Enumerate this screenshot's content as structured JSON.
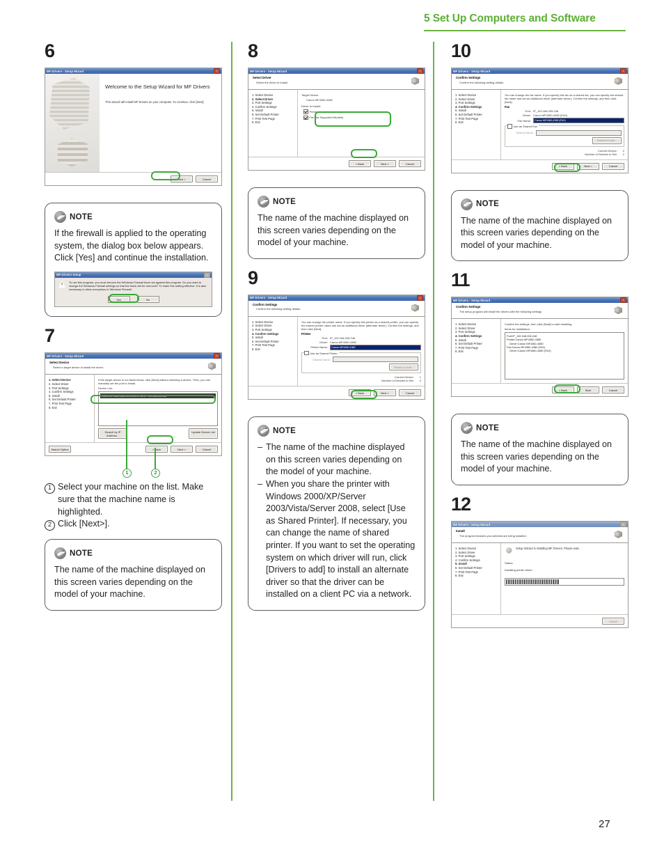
{
  "header": {
    "title": "5 Set Up Computers and Software"
  },
  "page_number": "27",
  "common": {
    "wizard_title": "MF Drivers - Setup Wizard",
    "steps": [
      "1.  Select Device",
      "2.  Select Driver",
      "3.  Port Settings",
      "4.  Confirm Settings",
      "5.  Install",
      "6.  Set Default Printer",
      "7.  Print Test Page",
      "8.  Exit"
    ],
    "btn_back": "< Back",
    "btn_next": "Next >",
    "btn_cancel": "Cancel",
    "btn_start": "Start",
    "note_label": "NOTE",
    "note_machine_name": "The name of the machine displayed on this screen varies depending on the model of your machine."
  },
  "step6": {
    "number": "6",
    "welcome_title": "Welcome to the Setup Wizard for MF Drivers",
    "welcome_body": "This wizard will install MF Drivers on your computer. To continue, click [Next].",
    "note": {
      "text": "If the firewall is applied to the operating system, the dialog box below appears. Click [Yes] and continue the installation.",
      "dialog": {
        "title": "MF Drivers Setup",
        "body": "To use this program, you must remove the Windows Firewall block set against this program. Do you want to change the Windows Firewall settings so that the block will be removed? To make this setting effective, it is also necessary to allow exceptions in Windows Firewall.",
        "yes": "Yes",
        "no": "No"
      }
    }
  },
  "step7": {
    "number": "7",
    "band_title": "Select Device",
    "band_sub": "Select a target device to install the driver.",
    "intro": "If the target device is not listed below, click [Next] without selecting a device. Then, you can manually set the port to install.",
    "list_label": "Device List:",
    "device_row": "Canon MF4360-4380   00:00:85:CF-80:0F   192.168.205.248",
    "btn_search_ip": "Search by IP Address...",
    "btn_update_list": "Update Device List",
    "btn_search_option": "Search Option",
    "callouts": [
      "1",
      "2"
    ],
    "instructions": [
      {
        "num": "1",
        "text": "Select your machine on the list. Make sure that the machine name is highlighted."
      },
      {
        "num": "2",
        "text": "Click [Next>]."
      }
    ]
  },
  "step8": {
    "number": "8",
    "band_title": "Select Driver",
    "band_sub": "Select the driver to install.",
    "target_label": "Target Device",
    "target_value": "Canon MF4360-4380",
    "driver_label": "Driver to Install:",
    "cb_printer": "Printer",
    "cb_fax": "Fax (for Supported Models)"
  },
  "step9": {
    "number": "9",
    "band_title": "Confirm Settings",
    "band_sub": "Confirm the following setting details.",
    "intro": "You can change the printer name. If you specify this printer as a shared printer, you can specify the shared printer name and set an additional driver (alternate driver). Confirm the settings, and then click [Next].",
    "section": "Printer",
    "port_key": "Port:",
    "port_value": "IP_192.168.205.248",
    "driver_key": "Driver:",
    "driver_value": "Canon MF4360-4380",
    "name_key": "Printer Name:",
    "name_value": "Canon MF4360-4380",
    "cb_shared": "Use as Shared Printer",
    "shared_key": "Shared Name:",
    "btn_drivers_add": "Drivers to Add...",
    "current_device_key": "Current Device:",
    "current_device_value": "1",
    "devices_to_set_key": "Number of Devices to Set:",
    "devices_to_set_value": "2",
    "note_items": [
      "The name of the machine displayed on this screen varies depending on the model of your machine.",
      "When you share the printer with Windows 2000/XP/Server 2003/Vista/Server 2008, select [Use as Shared Printer]. If necessary, you can change the name of shared printer. If you want to set the operating system on which driver will run, click [Drivers to add] to install an alternate driver so that the driver can be installed on a client PC via a network."
    ]
  },
  "step10": {
    "number": "10",
    "band_title": "Confirm Settings",
    "band_sub": "Confirm the following setting details.",
    "intro": "You can change the fax name. If you specify this fax as a shared fax, you can specify the shared fax name and set an additional driver (alternate driver). Confirm the settings, and then click [Next].",
    "section": "Fax",
    "port_key": "Port:",
    "port_value": "IP_192.168.205.248",
    "driver_key": "Driver:",
    "driver_value": "Canon MF4360-4380 (FAX)",
    "name_key": "Fax Name:",
    "name_value": "Canon MF4360-4380 (FAX)",
    "cb_shared": "Use as Shared Fax",
    "shared_key": "Shared Name:",
    "btn_drivers_add": "Drivers to Add...",
    "current_device_key": "Current Device:",
    "current_device_value": "2",
    "devices_to_set_key": "Number of Devices to Set:",
    "devices_to_set_value": "2"
  },
  "step11": {
    "number": "11",
    "band_title": "Confirm Settings",
    "band_sub": "The setup program will install the drivers with the following settings.",
    "intro": "Confirm the settings, then click [Start] to start installing.",
    "list_label": "Items for Installation:",
    "items": [
      "Port:IP_192.168.205.248",
      "Printer:Canon MF4360-4380",
      "    Driver:Canon MF4360-4380",
      "Fax:Canon MF4360-4380 (FAX)",
      "    Driver:Canon MF4360-4380 (FAX)"
    ]
  },
  "step12": {
    "number": "12",
    "band_title": "Install",
    "band_sub": "The program features you selected are being installed.",
    "message": "Setup Wizard is installing MF Drivers. Please wait...",
    "status_label": "Status:",
    "status_value": "Installing printer driver...",
    "btn_cancel": "Cancel"
  }
}
